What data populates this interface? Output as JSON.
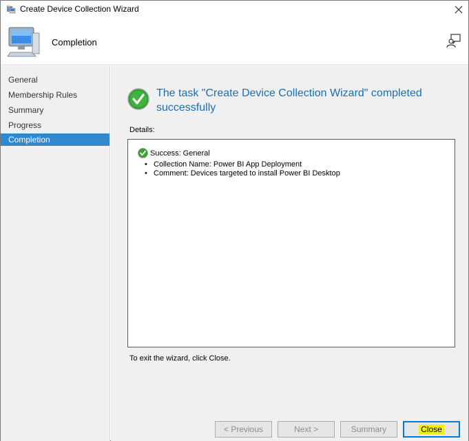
{
  "window": {
    "title": "Create Device Collection Wizard"
  },
  "header": {
    "title": "Completion"
  },
  "sidebar": {
    "items": [
      {
        "label": "General",
        "active": false
      },
      {
        "label": "Membership Rules",
        "active": false
      },
      {
        "label": "Summary",
        "active": false
      },
      {
        "label": "Progress",
        "active": false
      },
      {
        "label": "Completion",
        "active": true
      }
    ]
  },
  "main": {
    "status_message": "The task \"Create Device Collection Wizard\" completed successfully",
    "details_label": "Details:",
    "details": {
      "heading": "Success: General",
      "items": [
        "Collection Name: Power BI App Deployment",
        "Comment: Devices targeted to install Power BI Desktop"
      ]
    },
    "exit_hint": "To exit the wizard, click Close."
  },
  "buttons": {
    "previous": "< Previous",
    "next": "Next >",
    "summary": "Summary",
    "close": "Close"
  },
  "colors": {
    "accent": "#3388cc",
    "status_text": "#1a6fb5",
    "success_green": "#3aa13a",
    "highlight": "#f3f300"
  },
  "icons": {
    "title": "wizard-icon",
    "header": "computer-icon",
    "help": "user-help-icon",
    "status": "checkmark-icon"
  }
}
